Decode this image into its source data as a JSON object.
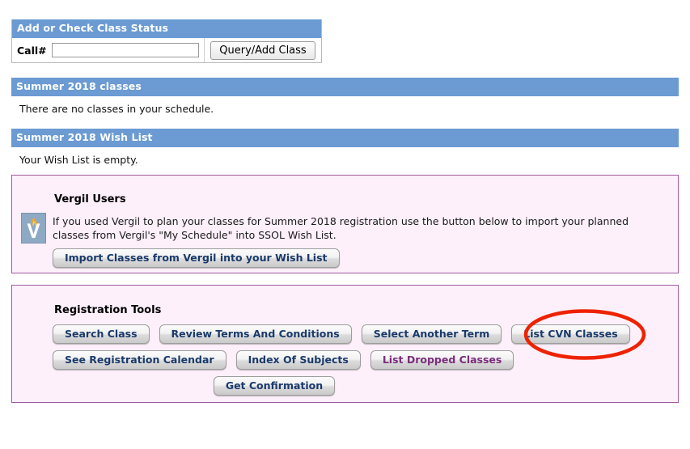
{
  "add_check": {
    "title": "Add or Check Class Status",
    "call_label": "Call#",
    "call_value": "",
    "call_placeholder": "",
    "query_button": "Query/Add Class"
  },
  "classes": {
    "title": "Summer 2018 classes",
    "message": "There are no classes in your schedule."
  },
  "wishlist": {
    "title": "Summer 2018 Wish List",
    "message": "Your Wish List is empty."
  },
  "vergil": {
    "heading": "Vergil Users",
    "logo_icon": "vergil-flame-logo",
    "description": "If you used Vergil to plan your classes for Summer 2018 registration use the button below to import your planned classes from Vergil's \"My Schedule\" into SSOL Wish List.",
    "import_button": "Import Classes from Vergil into your Wish List"
  },
  "tools": {
    "heading": "Registration Tools",
    "row1": [
      {
        "label": "Search Class",
        "style": "navy"
      },
      {
        "label": "Review Terms And Conditions",
        "style": "navy"
      },
      {
        "label": "Select Another Term",
        "style": "navy"
      },
      {
        "label": "List CVN Classes",
        "style": "navy"
      }
    ],
    "row2": [
      {
        "label": "See Registration Calendar",
        "style": "navy"
      },
      {
        "label": "Index Of Subjects",
        "style": "navy"
      },
      {
        "label": "List Dropped Classes",
        "style": "purple"
      }
    ],
    "row3": [
      {
        "label": "Get Confirmation",
        "style": "navy"
      }
    ]
  },
  "annotation": {
    "shape": "ellipse",
    "color": "#ee2200",
    "targets": "List CVN Classes"
  },
  "colors": {
    "header_bar": "#6b9bd2",
    "panel_background": "#fdf0fb",
    "panel_border": "#a05ba0",
    "button_text_navy": "#1a3a6b",
    "button_text_purple": "#7b2d7b",
    "annotation_red": "#ee2200"
  }
}
